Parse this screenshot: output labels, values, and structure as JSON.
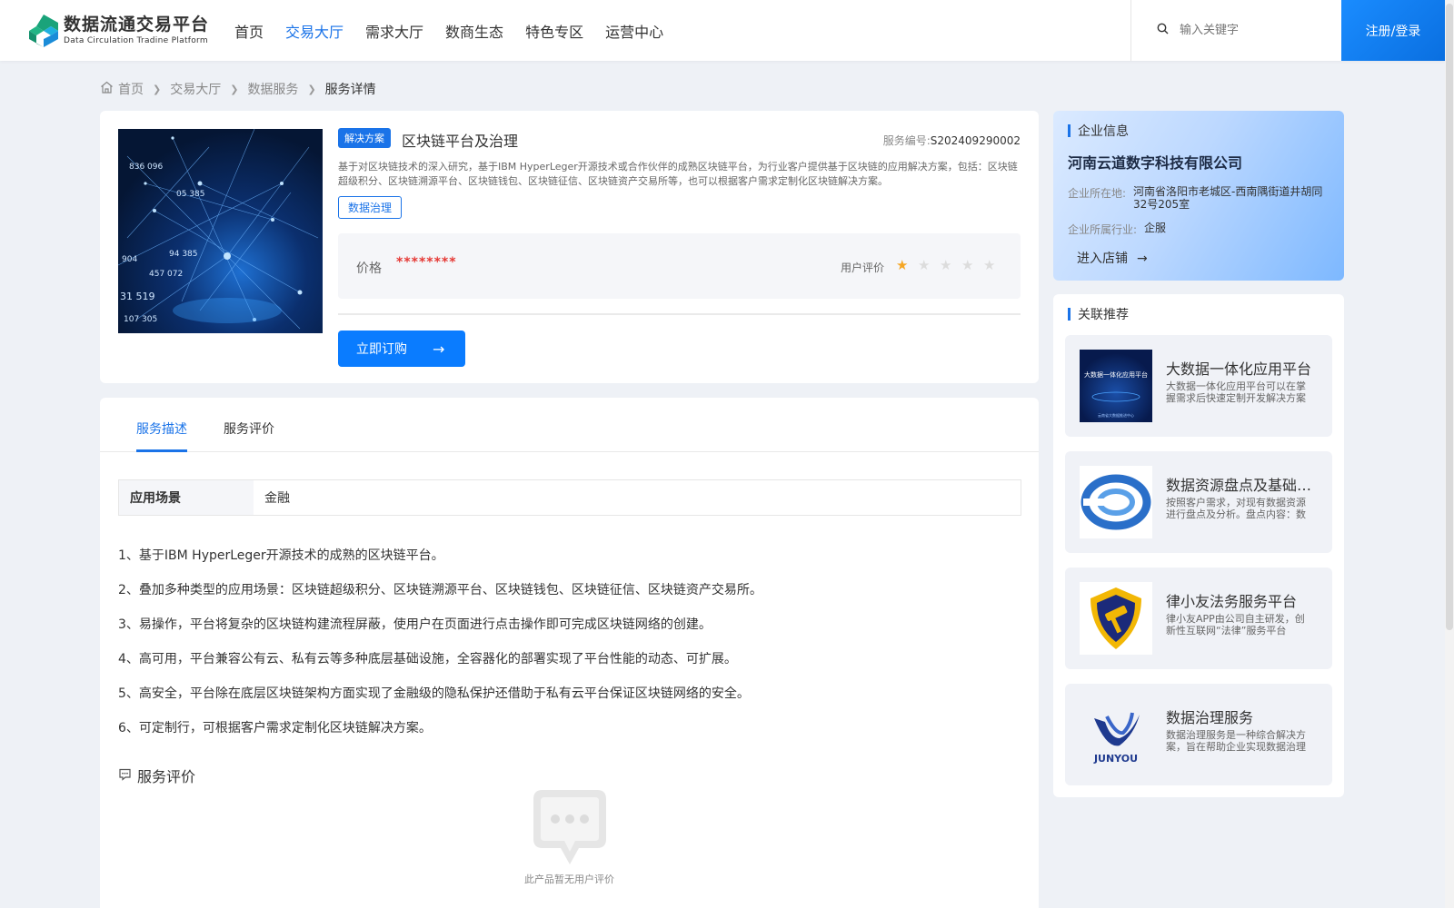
{
  "header": {
    "logo_title": "数据流通交易平台",
    "logo_subtitle": "Data Circulation Tradine Platform",
    "nav": [
      "首页",
      "交易大厅",
      "需求大厅",
      "数商生态",
      "特色专区",
      "运营中心"
    ],
    "active_nav": "交易大厅",
    "search_placeholder": "输入关键字",
    "login_label": "注册/登录"
  },
  "breadcrumb": [
    "首页",
    "交易大厅",
    "数据服务",
    "服务详情"
  ],
  "product": {
    "tag": "解决方案",
    "title": "区块链平台及治理",
    "service_no_label": "服务编号:",
    "service_no": "S202409290002",
    "description": "基于对区块链技术的深入研究，基于IBM HyperLeger开源技术或合作伙伴的成熟区块链平台，为行业客户提供基于区块链的应用解决方案，包括：区块链超级积分、区块链溯源平台、区块链钱包、区块链征信、区块链资产交易所等，也可以根据客户需求定制化区块链解决方案。",
    "chip": "数据治理",
    "price_label": "价格",
    "price_value": "********",
    "rating_label": "用户评价",
    "rating": 1,
    "rating_max": 5,
    "order_label": "立即订购"
  },
  "detail": {
    "tabs": [
      "服务描述",
      "服务评价"
    ],
    "active_tab": "服务描述",
    "scene_key": "应用场景",
    "scene_value": "金融",
    "points": [
      "1、基于IBM HyperLeger开源技术的成熟的区块链平台。",
      "2、叠加多种类型的应用场景：区块链超级积分、区块链溯源平台、区块链钱包、区块链征信、区块链资产交易所。",
      "3、易操作，平台将复杂的区块链构建流程屏蔽，使用户在页面进行点击操作即可完成区块链网络的创建。",
      "4、高可用，平台兼容公有云、私有云等多种底层基础设施，全容器化的部署实现了平台性能的动态、可扩展。",
      "5、高安全，平台除在底层区块链架构方面实现了金融级的隐私保护还借助于私有云平台保证区块链网络的安全。",
      "6、可定制行，可根据客户需求定制化区块链解决方案。"
    ],
    "review_title": "服务评价",
    "empty_text": "此产品暂无用户评价"
  },
  "company": {
    "section_title": "企业信息",
    "name": "河南云道数字科技有限公司",
    "location_label": "企业所在地:",
    "location": "河南省洛阳市老城区-西南隅街道井胡同32号205室",
    "industry_label": "企业所属行业:",
    "industry": "企服",
    "enter_label": "进入店铺"
  },
  "related": {
    "section_title": "关联推荐",
    "items": [
      {
        "title": "大数据一体化应用平台",
        "desc": "大数据一体化应用平台可以在掌握需求后快速定制开发解决方案",
        "image_text": "大数据一体化应用平台",
        "image_sub": "云南省大数据推进中心"
      },
      {
        "title": "数据资源盘点及基础治理服务",
        "desc": "按照客户需求，对现有数据资源进行盘点及分析。盘点内容：数据资源",
        "image_text": "",
        "image_sub": ""
      },
      {
        "title": "律小友法务服务平台",
        "desc": "律小友APP由公司自主研发，创新性互联网“法律”服务平台",
        "image_text": "",
        "image_sub": ""
      },
      {
        "title": "数据治理服务",
        "desc": "数据治理服务是一种综合解决方案，旨在帮助企业实现数据治理",
        "image_text": "JUNYOU",
        "image_sub": ""
      }
    ]
  },
  "image_labels": {
    "network_numbers": [
      "836 096",
      "904",
      "94 385",
      "457 072",
      "31 519",
      "107 305",
      "05 385"
    ]
  },
  "colors": {
    "accent": "#1a73e8",
    "price": "#e53935",
    "star_on": "#f5a623",
    "star_off": "#dcdcdc",
    "page_bg": "#eef1f6"
  }
}
